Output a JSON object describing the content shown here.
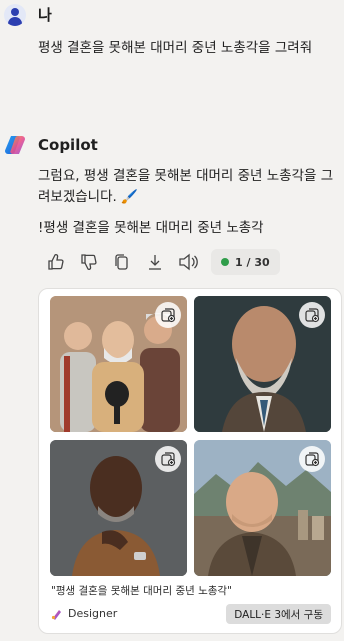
{
  "user": {
    "name": "나",
    "message": "평생 결혼을 못해본 대머리 중년 노총각을 그려줘"
  },
  "copilot": {
    "name": "Copilot",
    "reply": "그럼요, 평생 결혼을 못해본 대머리 중년 노총각을 그려보겠습니다. 🖌️",
    "reply_prompt": "!평생 결혼을 못해본 대머리 중년 노총각",
    "counter": "1 / 30"
  },
  "actions": [
    "thumbs-up-icon",
    "thumbs-down-icon",
    "copy-icon",
    "download-icon",
    "speaker-icon"
  ],
  "image_card": {
    "caption": "\"평생 결혼을 못해본 대머리 중년 노총각\"",
    "designer_label": "Designer",
    "badge": "DALL·E 3에서 구동",
    "images": [
      "group-of-older-bald-men-image",
      "bald-bearded-man-suit-image",
      "bald-man-thinking-image",
      "bald-man-city-mountains-image"
    ]
  },
  "colors": {
    "background": "#f3f2f0",
    "user_avatar": "#2c3fb0",
    "status_dot": "#2f9d4a"
  }
}
